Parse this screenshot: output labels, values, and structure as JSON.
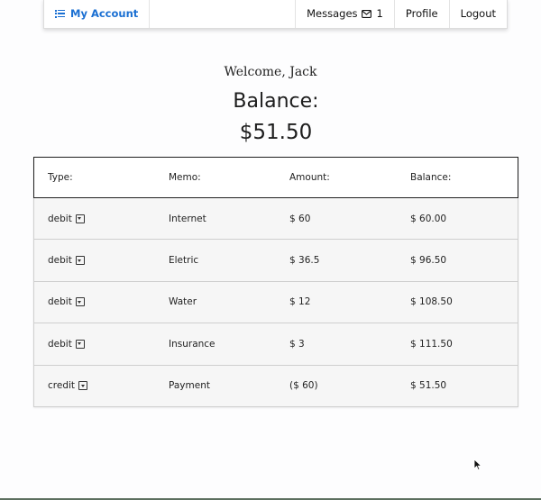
{
  "navbar": {
    "brand_label": "My Account",
    "brand_icon": "list-icon",
    "messages_label": "Messages",
    "messages_icon": "envelope-icon",
    "messages_count": "1",
    "profile_label": "Profile",
    "logout_label": "Logout",
    "accent_color": "#1a6fd2"
  },
  "header": {
    "welcome": "Welcome, Jack",
    "balance_label": "Balance:",
    "balance_value": "$51.50"
  },
  "table": {
    "columns": [
      "Type:",
      "Memo:",
      "Amount:",
      "Balance:"
    ],
    "rows": [
      {
        "type": "debit",
        "memo": "Internet",
        "amount": "$ 60",
        "balance": "$ 60.00"
      },
      {
        "type": "debit",
        "memo": "Eletric",
        "amount": "$ 36.5",
        "balance": "$ 96.50"
      },
      {
        "type": "debit",
        "memo": "Water",
        "amount": "$ 12",
        "balance": "$ 108.50"
      },
      {
        "type": "debit",
        "memo": "Insurance",
        "amount": "$ 3",
        "balance": "$ 111.50"
      },
      {
        "type": "credit",
        "memo": "Payment",
        "amount": "($ 60)",
        "balance": "$ 51.50"
      }
    ]
  }
}
